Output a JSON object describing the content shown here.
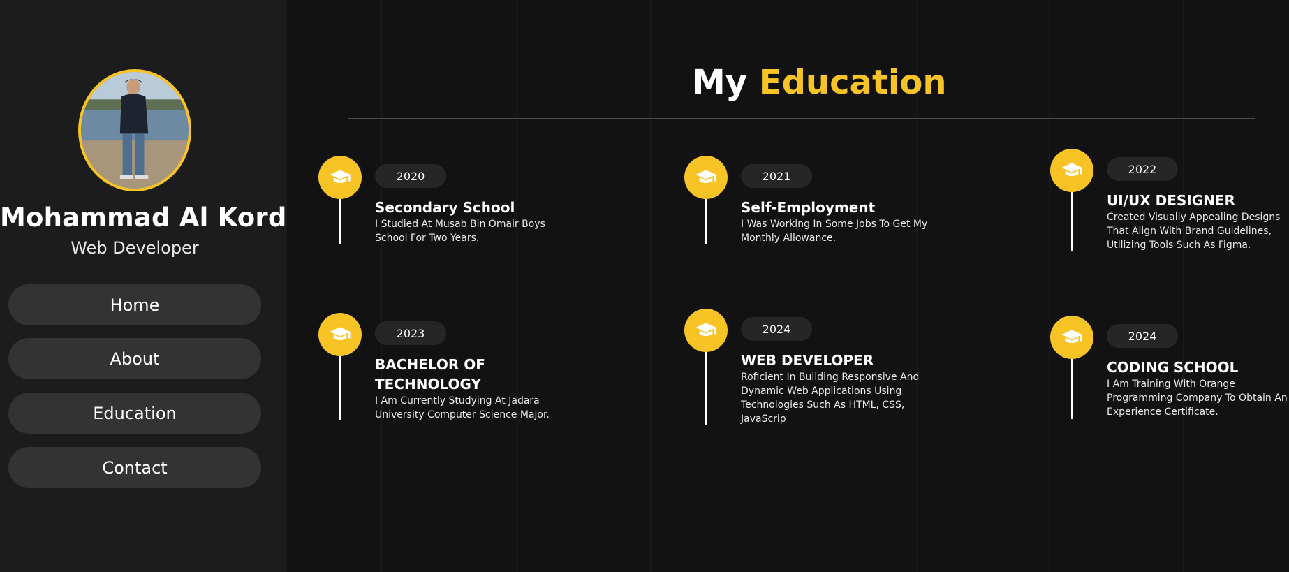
{
  "profile": {
    "name": "Mohammad Al Kordi",
    "role": "Web Developer",
    "avatar_alt": "profile photo"
  },
  "nav": {
    "home": "Home",
    "about": "About",
    "education": "Education",
    "contact": "Contact"
  },
  "section": {
    "title_plain": "My",
    "title_accent": "Education"
  },
  "colors": {
    "accent": "#f7c325",
    "background": "#121212",
    "sidebar": "#1c1c1c",
    "button": "#333333",
    "year_pill": "#262626"
  },
  "timeline": [
    {
      "year": "2020",
      "title": "Secondary School",
      "description": "I Studied At Musab Bin Omair Boys School For Two Years.",
      "icon": "graduation-cap-icon"
    },
    {
      "year": "2021",
      "title": "Self-Employment",
      "description": "I Was Working In Some Jobs To Get My Monthly Allowance.",
      "icon": "graduation-cap-icon"
    },
    {
      "year": "2022",
      "title": "UI/UX DESIGNER",
      "description": "Created Visually Appealing Designs That Align With Brand Guidelines, Utilizing Tools Such As Figma.",
      "icon": "graduation-cap-icon"
    },
    {
      "year": "2023",
      "title": "BACHELOR OF TECHNOLOGY",
      "description": "I Am Currently Studying At Jadara University Computer Science Major.",
      "icon": "graduation-cap-icon"
    },
    {
      "year": "2024",
      "title": "WEB DEVELOPER",
      "description": "Roficient In Building Responsive And Dynamic Web Applications Using Technologies Such As HTML, CSS, JavaScrip",
      "icon": "graduation-cap-icon"
    },
    {
      "year": "2024",
      "title": "CODING SCHOOL",
      "description": "I Am Training With Orange Programming Company To Obtain An Experience Certificate.",
      "icon": "graduation-cap-icon"
    }
  ]
}
